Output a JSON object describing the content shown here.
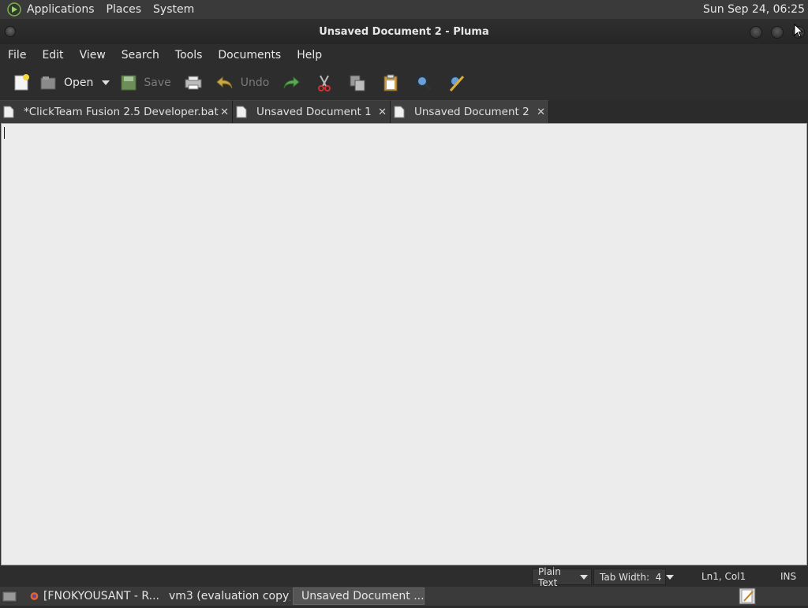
{
  "top_panel": {
    "menus": [
      "Applications",
      "Places",
      "System"
    ],
    "clock": "Sun Sep 24, 06:25"
  },
  "window": {
    "title": "Unsaved Document 2 - Pluma"
  },
  "menubar": [
    "File",
    "Edit",
    "View",
    "Search",
    "Tools",
    "Documents",
    "Help"
  ],
  "toolbar": {
    "open_label": "Open",
    "save_label": "Save",
    "undo_label": "Undo"
  },
  "tabs": [
    {
      "label": "*ClickTeam Fusion 2.5 Developer.bat"
    },
    {
      "label": "Unsaved Document 1"
    },
    {
      "label": "Unsaved Document 2"
    }
  ],
  "editor": {
    "content": ""
  },
  "statusbar": {
    "language": "Plain Text",
    "tab_width": "Tab Width:  4",
    "position": "Ln1, Col1",
    "mode": "INS"
  },
  "taskbar": {
    "items": [
      {
        "label": "[FNOKYOUSANT - R..."
      },
      {
        "label": "vm3 (evaluation copy)"
      },
      {
        "label": "Unsaved Document ..."
      }
    ]
  },
  "colors": {
    "panel_bg": "#3a3a3a",
    "window_bg": "#2d2d2d",
    "editor_bg": "#ececec"
  }
}
